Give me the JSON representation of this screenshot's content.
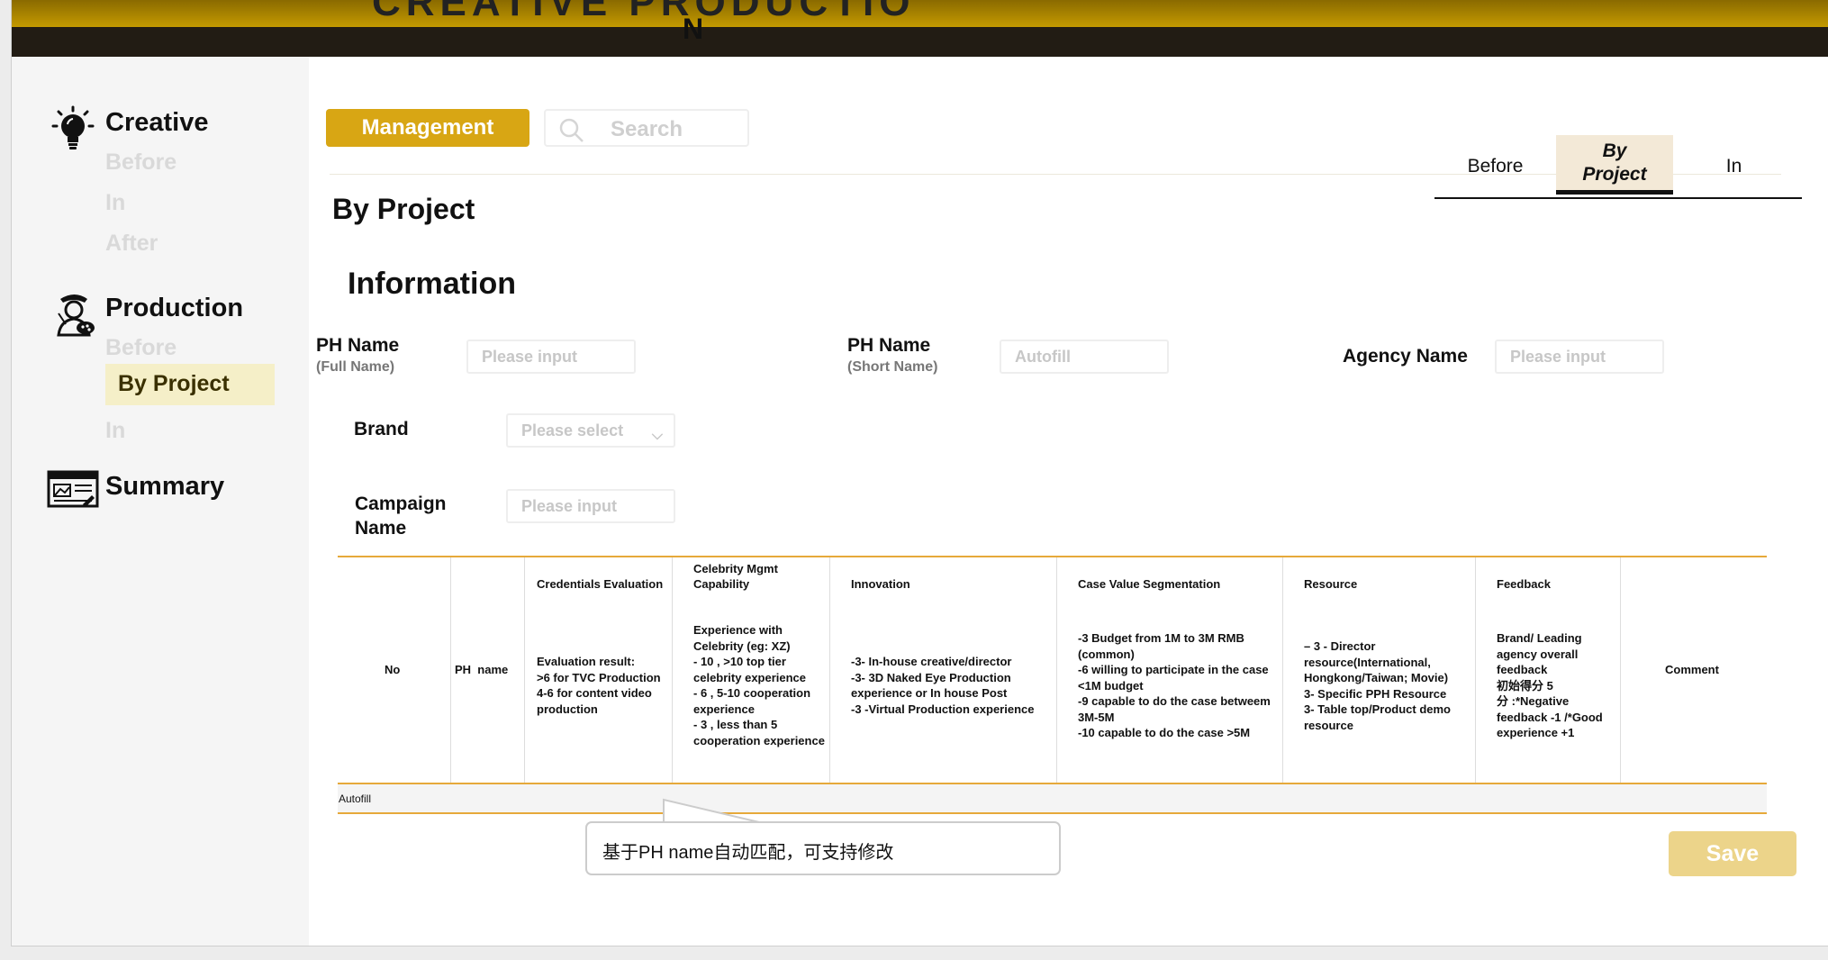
{
  "header": {
    "title_partial": "CREATIVE   PRODUCTIO",
    "title_wrap": "N"
  },
  "sidebar": {
    "creative": {
      "title": "Creative",
      "items": [
        "Before",
        "In",
        "After"
      ]
    },
    "production": {
      "title": "Production",
      "items": [
        "Before",
        "By Project",
        "In"
      ]
    },
    "summary": {
      "title": "Summary"
    }
  },
  "toolbar": {
    "management_label": "Management",
    "search_placeholder": "Search"
  },
  "tabs": [
    "Before",
    "By Project",
    "In"
  ],
  "page": {
    "title": "By Project",
    "section": "Information"
  },
  "form": {
    "ph_full": {
      "label": "PH Name",
      "sub": "(Full Name)",
      "placeholder": "Please input"
    },
    "ph_short": {
      "label": "PH Name",
      "sub": "(Short Name)",
      "placeholder": "Autofill"
    },
    "agency": {
      "label": "Agency Name",
      "placeholder": "Please input"
    },
    "brand": {
      "label": "Brand",
      "placeholder": "Please select"
    },
    "campaign": {
      "label_1": "Campaign",
      "label_2": "Name",
      "placeholder": "Please input"
    }
  },
  "table": {
    "headers": [
      "No",
      "PH  name",
      "Credentials Evaluation",
      "Celebrity Mgmt\nCapability",
      "Innovation",
      "Case Value Segmentation",
      "Resource",
      "Feedback",
      "Comment"
    ],
    "descriptions": {
      "credentials": "Evaluation result:\n>6  for TVC Production\n4-6 for content video\nproduction",
      "celebrity": "Experience with\nCelebrity (eg: XZ)\n  - 10 , >10 top tier\ncelebrity  experience\n  - 6   , 5-10 cooperation\nexperience\n  - 3  , less than 5\ncooperation experience",
      "innovation": "-3- In-house creative/director\n-3- 3D Naked Eye Production\nexperience or In house Post\n-3 -Virtual Production experience",
      "case_value": "-3 Budget from 1M to 3M RMB\n(common)\n-6 willing to participate in the case\n<1M budget\n-9 capable to do the case betweem\n3M-5M\n-10 capable to do the case >5M",
      "resource": "– 3 - Director\nresource(International,\nHongkong/Taiwan; Movie)\n3- Specific PPH Resource\n3- Table top/Product demo\nresource",
      "feedback": "Brand/ Leading\nagency overall\nfeedback\n初始得分 5\n分 :*Negative\nfeedback -1 /*Good\nexperience +1"
    },
    "row_autofill": "Autofill"
  },
  "tooltip": {
    "text": "基于PH name自动匹配，可支持修改"
  },
  "actions": {
    "save_label": "Save"
  },
  "colors": {
    "accent": "#d8a614",
    "table_line": "#e6a93a",
    "save_disabled": "#ecd48a",
    "active_nav_bg": "#f5efc8"
  },
  "icons": {
    "creative": "lightbulb-icon",
    "production": "painter-icon",
    "summary": "browser-window-icon",
    "search": "search-icon"
  }
}
